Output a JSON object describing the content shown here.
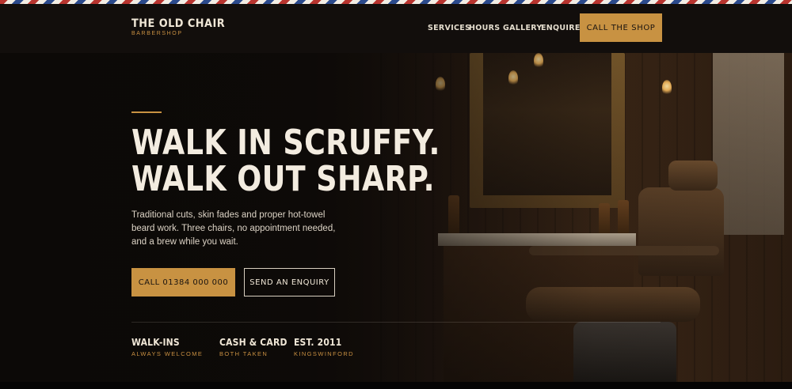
{
  "brand": {
    "name": "THE OLD CHAIR",
    "tagline": "BARBERSHOP"
  },
  "nav": {
    "items": [
      {
        "label": "SERVICES"
      },
      {
        "label": "HOURS"
      },
      {
        "label": "GALLERY"
      },
      {
        "label": "ENQUIRE"
      }
    ],
    "cta_label": "CALL THE SHOP"
  },
  "hero": {
    "headline_line1": "WALK IN SCRUFFY.",
    "headline_line2": "WALK OUT SHARP.",
    "subcopy": "Traditional cuts, skin fades and proper hot-towel beard work. Three chairs, no appointment needed, and a brew while you wait.",
    "primary_button": "CALL 01384 000 000",
    "secondary_button": "SEND AN ENQUIRY",
    "image_description": "barbershop-interior-photo"
  },
  "features": [
    {
      "title": "WALK-INS",
      "subtitle": "ALWAYS WELCOME"
    },
    {
      "title": "CASH & CARD",
      "subtitle": "BOTH TAKEN"
    },
    {
      "title": "EST. 2011",
      "subtitle": "KINGSWINFORD"
    }
  ],
  "colors": {
    "accent": "#c89242",
    "background": "#0f0c0a",
    "text": "#efe6d6",
    "stripe_red": "#b8342f",
    "stripe_blue": "#2b4a8c"
  }
}
